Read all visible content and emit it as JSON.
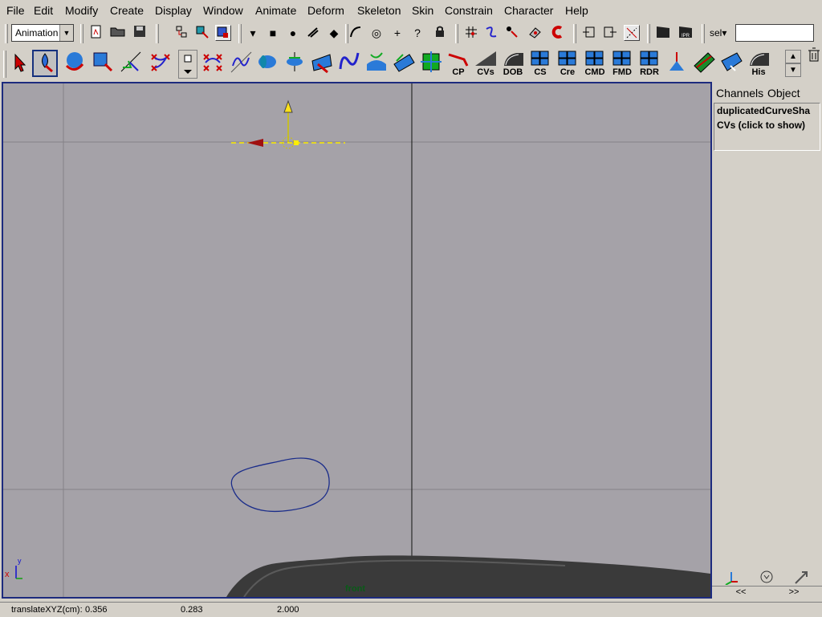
{
  "menubar": {
    "items": [
      "File",
      "Edit",
      "Modify",
      "Create",
      "Display",
      "Window",
      "Animate",
      "Deform",
      "Skeleton",
      "Skin",
      "Constrain",
      "Character",
      "Help"
    ]
  },
  "statusline": {
    "mode": "Animation",
    "sel_label": "sel▾",
    "sel_value": ""
  },
  "shelf": {
    "labels": [
      "CP",
      "CVs",
      "DOB",
      "CS",
      "Cre",
      "CMD",
      "FMD",
      "RDR",
      "His"
    ]
  },
  "viewport": {
    "camera_name": "front",
    "axis_x": "x",
    "axis_y": "y",
    "background_color": "#a5a2a8",
    "curve_color": "#1b2d8a"
  },
  "channel_box": {
    "tab_channels": "Channels",
    "tab_object": "Object",
    "object_name": "duplicatedCurveSha",
    "cvs_label": "CVs (click to show)",
    "scroll_left": "<<",
    "scroll_right": ">>"
  },
  "helpline": {
    "label": "translateXYZ(cm):",
    "x": "0.356",
    "y": "0.283",
    "z": "2.000"
  }
}
